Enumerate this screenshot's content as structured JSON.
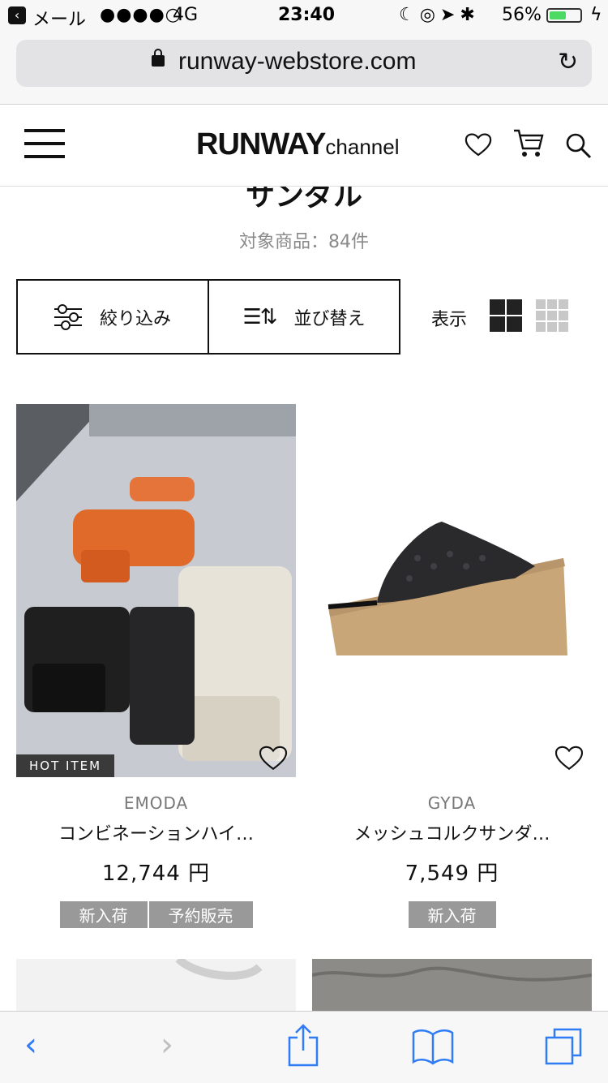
{
  "status_bar": {
    "back_app": "メール",
    "signal": "●●●●○",
    "network": "4G",
    "time": "23:40",
    "battery_percent": "56%",
    "battery_level": 0.56
  },
  "browser": {
    "url": "runway-webstore.com"
  },
  "header": {
    "logo_main": "RUNWAY",
    "logo_sub": "channel"
  },
  "category": {
    "title": "サンダル",
    "count_text": "対象商品：84件"
  },
  "controls": {
    "filter_label": "絞り込み",
    "sort_label": "並び替え",
    "view_label": "表示"
  },
  "products": [
    {
      "brand": "EMODA",
      "name": "コンビネーションハイ…",
      "price": "12,744 円",
      "badge": "HOT ITEM",
      "tags": [
        "新入荷",
        "予約販売"
      ]
    },
    {
      "brand": "GYDA",
      "name": "メッシュコルクサンダ…",
      "price": "7,549 円",
      "tags": [
        "新入荷"
      ]
    }
  ],
  "colors": {
    "accent": "#2f7cf6",
    "tag_bg": "#999999",
    "battery": "#4cd964"
  }
}
